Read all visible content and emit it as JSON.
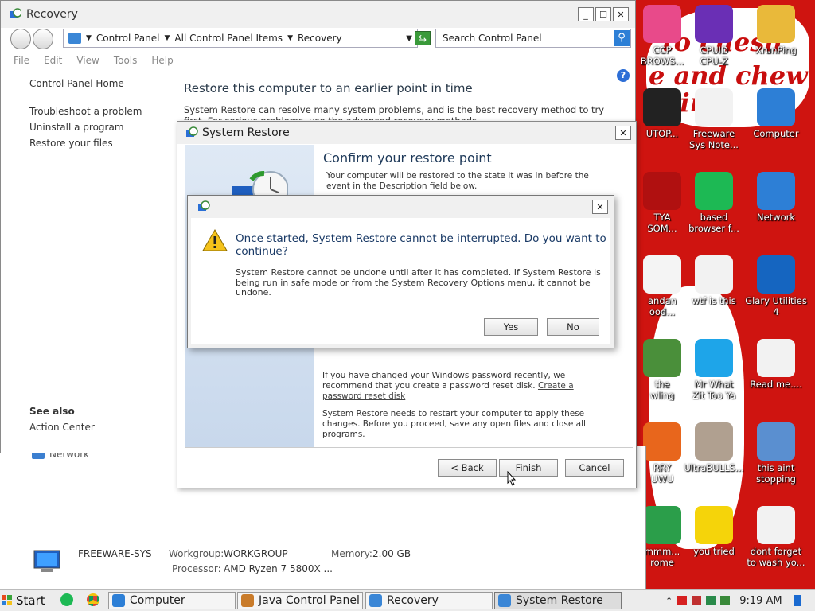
{
  "desktop": {
    "wallpaper_text": [
      "to chesh",
      "e and chew",
      "illin"
    ],
    "icons": [
      {
        "label": "CCP\nBROWS...",
        "icon": "ccp-browser-icon",
        "color": "#e84a8a"
      },
      {
        "label": "CPUID\nCPU-Z",
        "icon": "cpuz-icon",
        "color": "#6a2fb5"
      },
      {
        "label": "XrunPing",
        "icon": "folder-user-icon",
        "color": "#e9b93a"
      },
      {
        "label": "UTOP...",
        "icon": "utop-icon",
        "color": "#222222"
      },
      {
        "label": "Freeware\nSys Note...",
        "icon": "text-file-icon",
        "color": "#f2f2f2"
      },
      {
        "label": "Computer",
        "icon": "computer-icon",
        "color": "#2d7fd6"
      },
      {
        "label": "TYA\nSOM...",
        "icon": "skull-icon",
        "color": "#b01010"
      },
      {
        "label": "based\nbrowser f...",
        "icon": "green-chat-icon",
        "color": "#1db954"
      },
      {
        "label": "Network",
        "icon": "network-globe-icon",
        "color": "#2d7fd6"
      },
      {
        "label": "andan\nood...",
        "icon": "meme-face-icon",
        "color": "#f4f4f4"
      },
      {
        "label": "wtf is this",
        "icon": "calendar-file-icon",
        "color": "#f2f2f2"
      },
      {
        "label": "Glary Utilities\n4",
        "icon": "glary-icon",
        "color": "#1565c0"
      },
      {
        "label": "the\nwling",
        "icon": "santa-icon",
        "color": "#4a8f3a"
      },
      {
        "label": "Mr What\nZit Too Ya",
        "icon": "skype-icon",
        "color": "#1ea5e9"
      },
      {
        "label": "Read me....",
        "icon": "text-file-icon",
        "color": "#f2f2f2"
      },
      {
        "label": "RRY\nUWU",
        "icon": "firefox-icon",
        "color": "#e8661c"
      },
      {
        "label": "UltraBULLS...",
        "icon": "disc-icon",
        "color": "#b0a090"
      },
      {
        "label": "this aint\nstopping dic...",
        "icon": "computer-search-icon",
        "color": "#5a8fd0"
      },
      {
        "label": "mmm...\nrome",
        "icon": "chrome-icon",
        "color": "#2b9e4a"
      },
      {
        "label": "you tried",
        "icon": "star-icon",
        "color": "#f5d40a"
      },
      {
        "label": "dont forget\nto wash yo...",
        "icon": "calendar-file-icon",
        "color": "#f2f2f2"
      }
    ]
  },
  "background_window": {
    "network_label": "Network",
    "computer_name": "FREEWARE-SYS",
    "workgroup_label": "Workgroup:",
    "workgroup_value": "WORKGROUP",
    "memory_label": "Memory:",
    "memory_value": "2.00 GB",
    "processor_label": "Processor:",
    "processor_value": "AMD Ryzen 7 5800X ..."
  },
  "recovery_window": {
    "title": "Recovery",
    "breadcrumb": [
      "Control Panel",
      "All Control Panel Items",
      "Recovery"
    ],
    "search_placeholder": "Search Control Panel",
    "menu": [
      "File",
      "Edit",
      "View",
      "Tools",
      "Help"
    ],
    "nav_home": "Control Panel Home",
    "nav_links": [
      "Troubleshoot a problem",
      "Uninstall a program",
      "Restore your files"
    ],
    "see_also_heading": "See also",
    "see_also_links": [
      "Action Center"
    ],
    "heading": "Restore this computer to an earlier point in time",
    "description": "System Restore can resolve many system problems, and is the best recovery method to try first. For serious problems, use the advanced recovery methods."
  },
  "system_restore": {
    "title": "System Restore",
    "heading": "Confirm your restore point",
    "intro": "Your computer will be restored to the state it was in before the event in the Description field below.",
    "password_note": "If you have changed your Windows password recently, we recommend that you create a password reset disk.",
    "password_link": "Create a password reset disk",
    "restart_note": "System Restore needs to restart your computer to apply these changes. Before you proceed, save any open files and close all programs.",
    "back_button": "< Back",
    "finish_button": "Finish",
    "cancel_button": "Cancel"
  },
  "confirm_dialog": {
    "main_instruction": "Once started, System Restore cannot be interrupted. Do you want to continue?",
    "content": "System Restore cannot be undone until after it has completed. If System Restore is being run in safe mode or from the System Recovery Options menu, it cannot be undone.",
    "yes_button": "Yes",
    "no_button": "No"
  },
  "taskbar": {
    "start_label": "Start",
    "buttons": [
      {
        "label": "Computer",
        "active": false
      },
      {
        "label": "Java Control Panel",
        "active": false
      },
      {
        "label": "Recovery",
        "active": false
      },
      {
        "label": "System Restore",
        "active": true
      }
    ],
    "clock": "9:19 AM"
  }
}
